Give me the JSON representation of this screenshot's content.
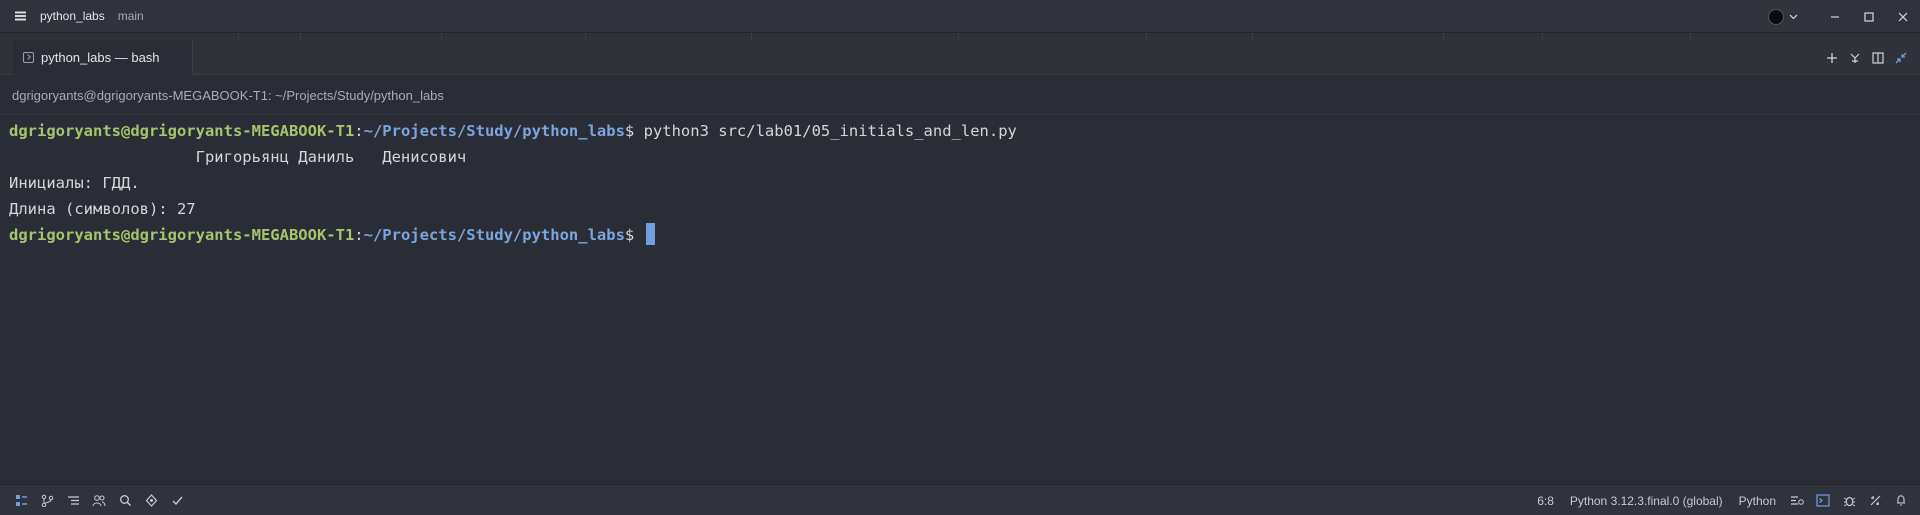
{
  "window": {
    "title": "python_labs",
    "branch": "main"
  },
  "tabs": [
    {
      "label": "python_labs — bash",
      "icon": "terminal-icon"
    }
  ],
  "tab_actions": [
    "plus-icon",
    "split-icon",
    "layout-icon",
    "collapse-icon"
  ],
  "pathbar": {
    "text": "dgrigoryants@dgrigoryants-MEGABOOK-T1: ~/Projects/Study/python_labs"
  },
  "terminal": {
    "prompt_user": "dgrigoryants@dgrigoryants-MEGABOOK-T1",
    "prompt_colon": ":",
    "prompt_path": "~/Projects/Study/python_labs",
    "prompt_dollar": "$ ",
    "command": "python3 src/lab01/05_initials_and_len.py",
    "output": [
      "                    Григорьянц Даниль   Денисович",
      "Инициалы: ГДД.",
      "Длина (символов): 27"
    ]
  },
  "statusbar": {
    "left_icons": [
      "project-icon",
      "git-branch-icon",
      "list-icon",
      "users-icon",
      "search-icon",
      "bolt-icon",
      "check-icon"
    ],
    "cursor_position": "6:8",
    "interpreter": "Python 3.12.3.final.0 (global)",
    "language": "Python"
  },
  "colors": {
    "background": "#2a2d35",
    "prompt_user": "#a5c46d",
    "prompt_path": "#7aa5df",
    "cursor": "#6f9fe0"
  }
}
